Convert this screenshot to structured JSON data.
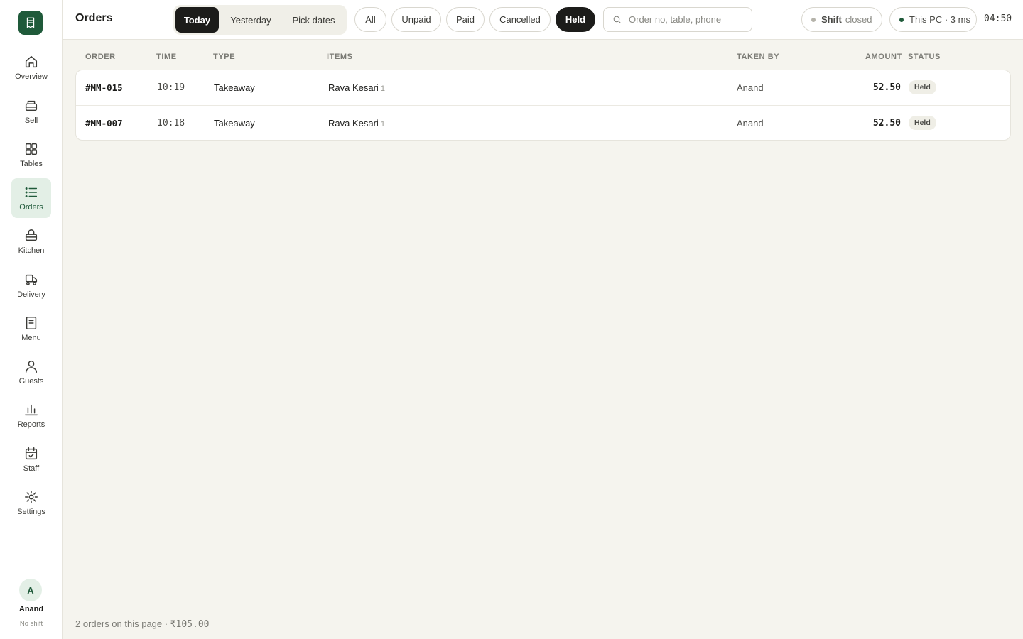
{
  "header": {
    "title": "Orders",
    "date_tabs": [
      "Today",
      "Yesterday",
      "Pick dates"
    ],
    "active_date_tab": "Today",
    "filters": [
      "All",
      "Unpaid",
      "Paid",
      "Cancelled",
      "Held"
    ],
    "active_filter": "Held",
    "search_placeholder": "Order no, table, phone",
    "shift_label": "Shift",
    "shift_status": "closed",
    "device": "This PC · 3 ms",
    "clock": "04:50"
  },
  "sidebar": {
    "items": [
      {
        "label": "Overview",
        "icon": "home-icon"
      },
      {
        "label": "Sell",
        "icon": "register-icon"
      },
      {
        "label": "Tables",
        "icon": "grid-icon"
      },
      {
        "label": "Orders",
        "icon": "list-icon",
        "active": true
      },
      {
        "label": "Kitchen",
        "icon": "basket-icon"
      },
      {
        "label": "Delivery",
        "icon": "delivery-icon"
      },
      {
        "label": "Menu",
        "icon": "document-icon"
      },
      {
        "label": "Guests",
        "icon": "user-icon"
      },
      {
        "label": "Reports",
        "icon": "bar-chart-icon"
      },
      {
        "label": "Staff",
        "icon": "calendar-check-icon"
      },
      {
        "label": "Settings",
        "icon": "sun-gear-icon"
      }
    ],
    "user": {
      "initial": "A",
      "name": "Anand",
      "status": "No shift"
    }
  },
  "table": {
    "columns": [
      "ORDER",
      "TIME",
      "TYPE",
      "ITEMS",
      "TAKEN BY",
      "AMOUNT",
      "STATUS"
    ],
    "rows": [
      {
        "order": "#MM-015",
        "time": "10:19",
        "type": "Takeaway",
        "item": "Rava Kesari",
        "qty": "1",
        "taken_by": "Anand",
        "amount": "52.50",
        "status": "Held"
      },
      {
        "order": "#MM-007",
        "time": "10:18",
        "type": "Takeaway",
        "item": "Rava Kesari",
        "qty": "1",
        "taken_by": "Anand",
        "amount": "52.50",
        "status": "Held"
      }
    ]
  },
  "footer": {
    "summary": "2 orders on this page · ",
    "total": "₹105.00"
  },
  "colors": {
    "brand": "#1f5a3a",
    "active_chip": "#1c1c1a",
    "background": "#f5f4ee",
    "shift_dot": "#b5b3aa",
    "device_dot": "#1f5a3a"
  }
}
